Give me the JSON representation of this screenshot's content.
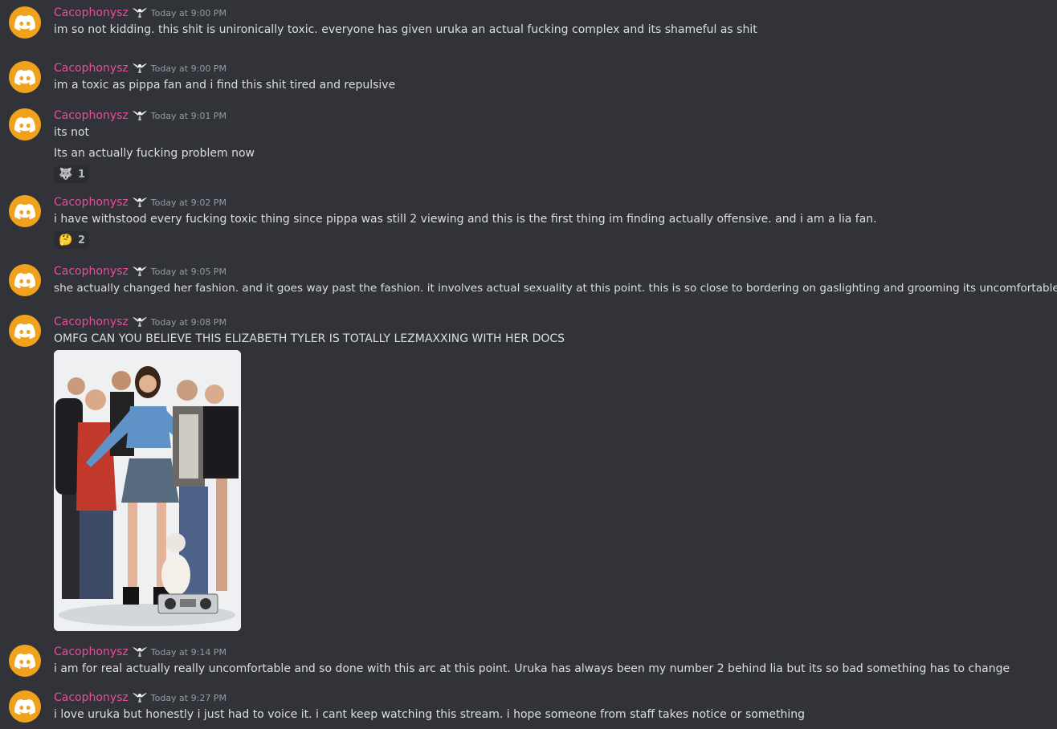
{
  "colors": {
    "background": "#313338",
    "username": "#e84e9a",
    "avatar": "#f0a21c",
    "timestamp": "#949ba4",
    "text": "#dbdee1"
  },
  "icons": {
    "avatar": "discord-logo-icon",
    "user_tag": "winged-tag-icon",
    "reaction_1": "wolf-emoji-icon",
    "reaction_2": "thinking-face-emoji-icon"
  },
  "messages": [
    {
      "username": "Cacophonysz",
      "timestamp": "Today at 9:00 PM",
      "lines": [
        "im so not kidding. this shit is unironically toxic. everyone has given uruka an actual fucking complex and its shameful as shit"
      ]
    },
    {
      "username": "Cacophonysz",
      "timestamp": "Today at 9:00 PM",
      "lines": [
        "im a toxic as pippa fan and i find this shit tired and repulsive"
      ]
    },
    {
      "username": "Cacophonysz",
      "timestamp": "Today at 9:01 PM",
      "lines": [
        "its not",
        "Its an actually fucking problem now"
      ],
      "reaction": {
        "emoji": "🐺",
        "count": "1"
      }
    },
    {
      "username": "Cacophonysz",
      "timestamp": "Today at 9:02 PM",
      "lines": [
        "i have withstood every fucking toxic thing since pippa was still 2 viewing and this is the first thing im finding actually offensive. and i am a lia fan."
      ],
      "reaction": {
        "emoji": "🤔",
        "count": "2"
      }
    },
    {
      "username": "Cacophonysz",
      "timestamp": "Today at 9:05 PM",
      "lines": [
        "she actually changed her fashion. and it goes way past the fashion. it involves actual sexuality at this point. this is so close to bordering on gaslighting and grooming its uncomfortable"
      ]
    },
    {
      "username": "Cacophonysz",
      "timestamp": "Today at 9:08 PM",
      "lines": [
        "OMFG CAN YOU BELIEVE THIS ELIZABETH TYLER IS TOTALLY LEZMAXXING WITH HER DOCS"
      ],
      "attachment": "group-photo"
    },
    {
      "username": "Cacophonysz",
      "timestamp": "Today at 9:14 PM",
      "lines": [
        "i am for real actually really uncomfortable and so done with this arc at this point. Uruka has always been my number 2 behind lia but its so bad something has to change"
      ]
    },
    {
      "username": "Cacophonysz",
      "timestamp": "Today at 9:27 PM",
      "lines": [
        "i love uruka but honestly i just had to voice it. i cant keep watching this stream. i hope someone from staff takes notice or something"
      ]
    }
  ]
}
